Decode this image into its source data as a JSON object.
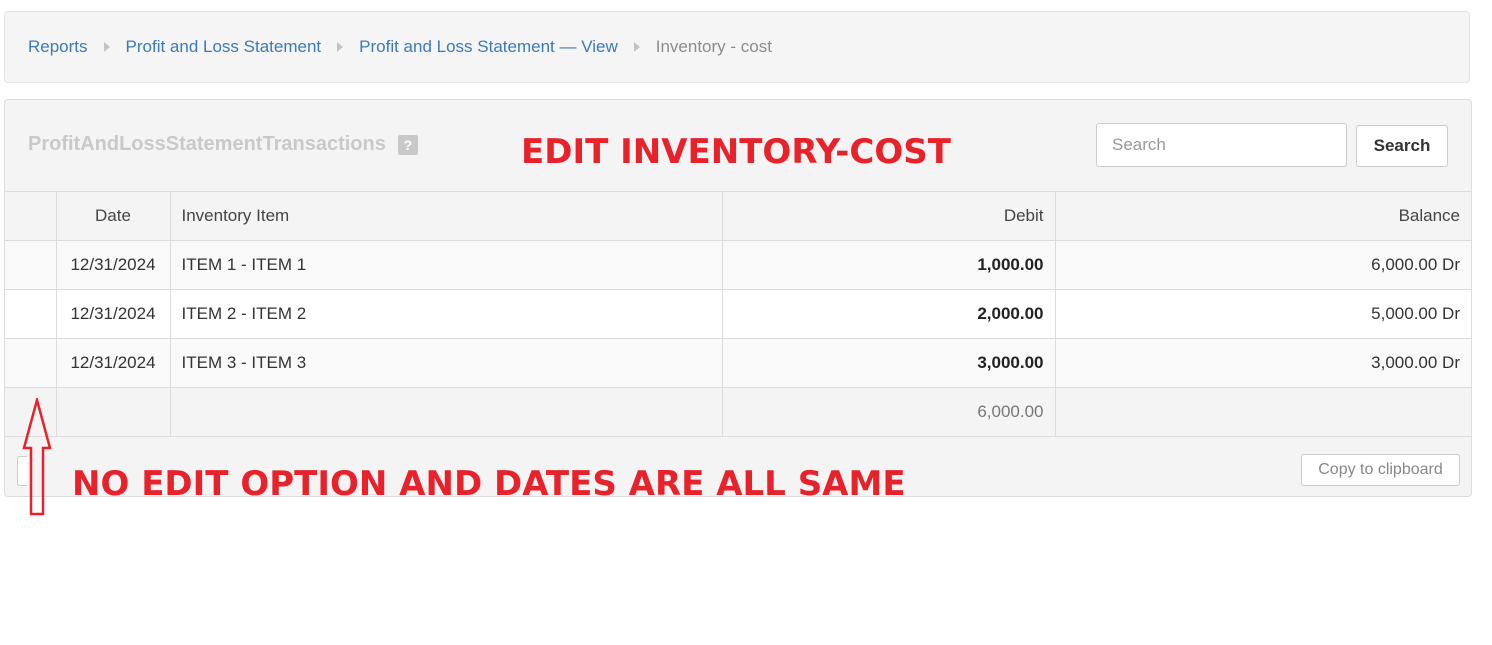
{
  "breadcrumb": {
    "items": [
      "Reports",
      "Profit and Loss Statement",
      "Profit and Loss Statement — View"
    ],
    "current": "Inventory - cost"
  },
  "panel": {
    "title": "ProfitAndLossStatementTransactions",
    "help_icon": "question-mark-icon",
    "help_glyph": "?"
  },
  "search": {
    "placeholder": "Search",
    "button_label": "Search"
  },
  "table": {
    "headers": {
      "select": "",
      "date": "Date",
      "item": "Inventory Item",
      "debit": "Debit",
      "balance": "Balance"
    },
    "rows": [
      {
        "date": "12/31/2024",
        "item": "ITEM 1 - ITEM 1",
        "debit": "1,000.00",
        "balance": "6,000.00 Dr"
      },
      {
        "date": "12/31/2024",
        "item": "ITEM 2 - ITEM 2",
        "debit": "2,000.00",
        "balance": "5,000.00 Dr"
      },
      {
        "date": "12/31/2024",
        "item": "ITEM 3 - ITEM 3",
        "debit": "3,000.00",
        "balance": "3,000.00 Dr"
      }
    ],
    "total_debit": "6,000.00"
  },
  "footer": {
    "copy_label": "Copy to clipboard"
  },
  "annotations": {
    "top": "EDIT INVENTORY-COST",
    "bottom": "NO EDIT OPTION AND DATES ARE ALL SAME",
    "color": "#e8222b",
    "arrow_icon": "up-arrow-icon"
  }
}
